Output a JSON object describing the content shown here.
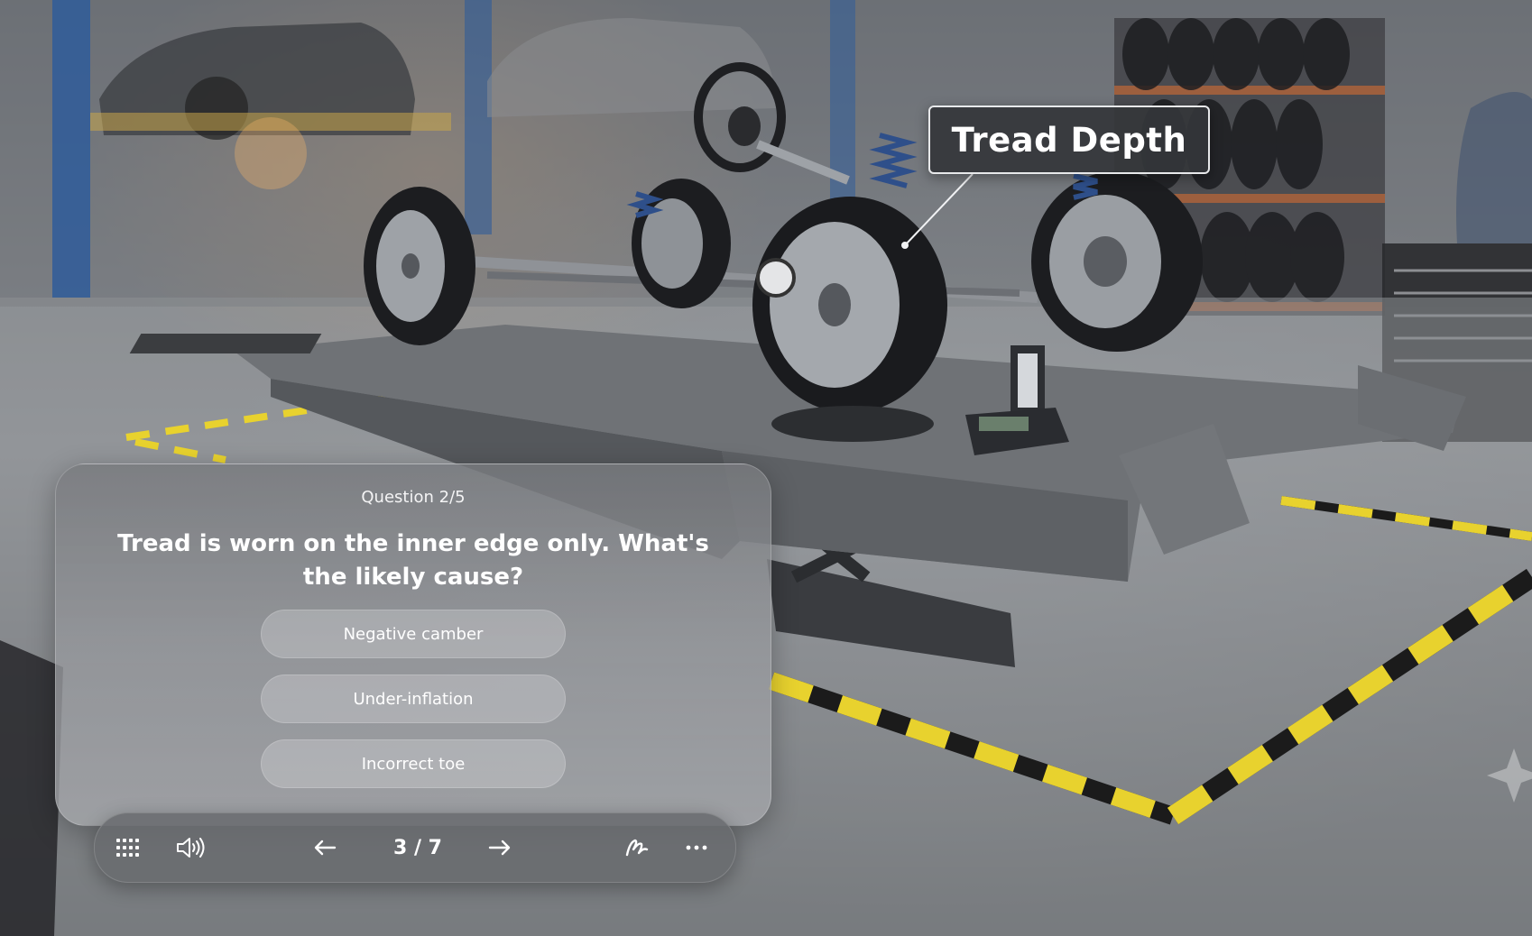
{
  "callout": {
    "label": "Tread Depth"
  },
  "quiz": {
    "counter": "Question 2/5",
    "question": "Tread is worn on the inner edge only. What's the likely cause?",
    "answers": [
      {
        "label": "Negative camber"
      },
      {
        "label": "Under-inflation"
      },
      {
        "label": "Incorrect toe"
      }
    ]
  },
  "toolbar": {
    "page_indicator": "3 / 7",
    "icons": [
      "grid-icon",
      "speaker-icon",
      "arrow-left-icon",
      "arrow-right-icon",
      "pen-icon",
      "more-icon"
    ]
  },
  "colors": {
    "callout_bg": "#34363a",
    "panel_bg": "#8a8c90",
    "hazard_yellow": "#e8d22e"
  }
}
